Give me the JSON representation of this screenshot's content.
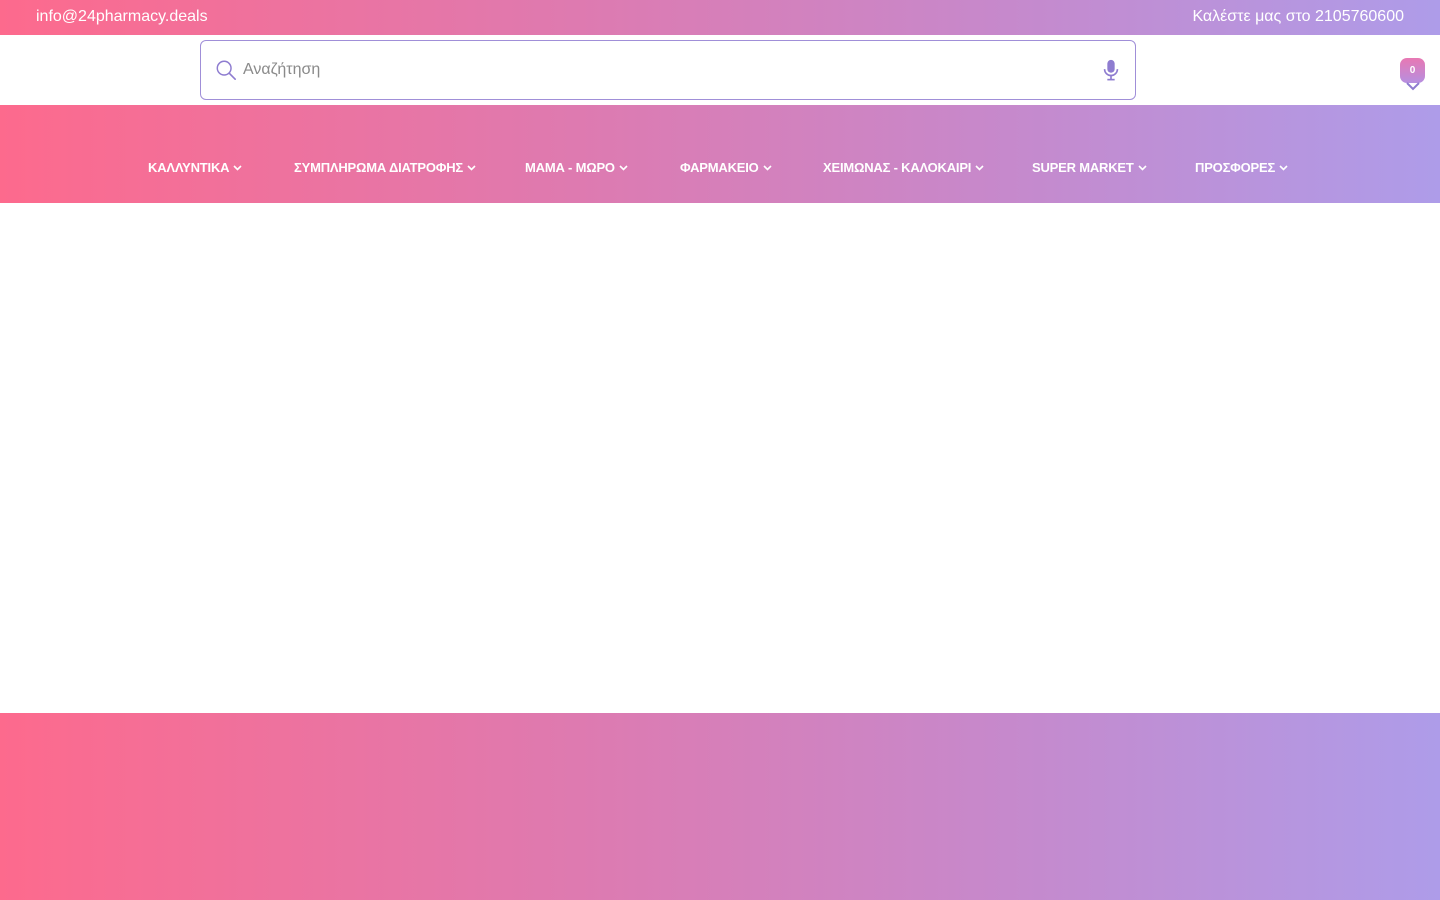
{
  "topbar": {
    "email": "info@24pharmacy.deals",
    "phone": "Καλέστε μας στο 2105760600"
  },
  "search": {
    "placeholder": "Αναζήτηση",
    "value": "",
    "left_icon": "search-icon",
    "right_icon": "microphone-icon"
  },
  "cart": {
    "count": "0",
    "icon": "chevron-down-icon"
  },
  "nav": {
    "items": [
      {
        "label": "ΚΑΛΛΥΝΤΙΚΑ"
      },
      {
        "label": "ΣΥΜΠΛΗΡΩΜΑ ΔΙΑΤΡΟΦΗΣ"
      },
      {
        "label": "ΜΑΜΑ - ΜΩΡΟ"
      },
      {
        "label": "ΦΑΡΜΑΚΕΙΟ"
      },
      {
        "label": "ΧΕΙΜΩΝΑΣ - ΚΑΛΟΚΑΙΡΙ"
      },
      {
        "label": "SUPER MARKET"
      },
      {
        "label": "ΠΡΟΣΦΟΡΕΣ"
      }
    ]
  },
  "colors": {
    "gradient_start": "#fd6a8d",
    "gradient_end": "#ae9ce9",
    "accent": "#8e7cd0"
  }
}
